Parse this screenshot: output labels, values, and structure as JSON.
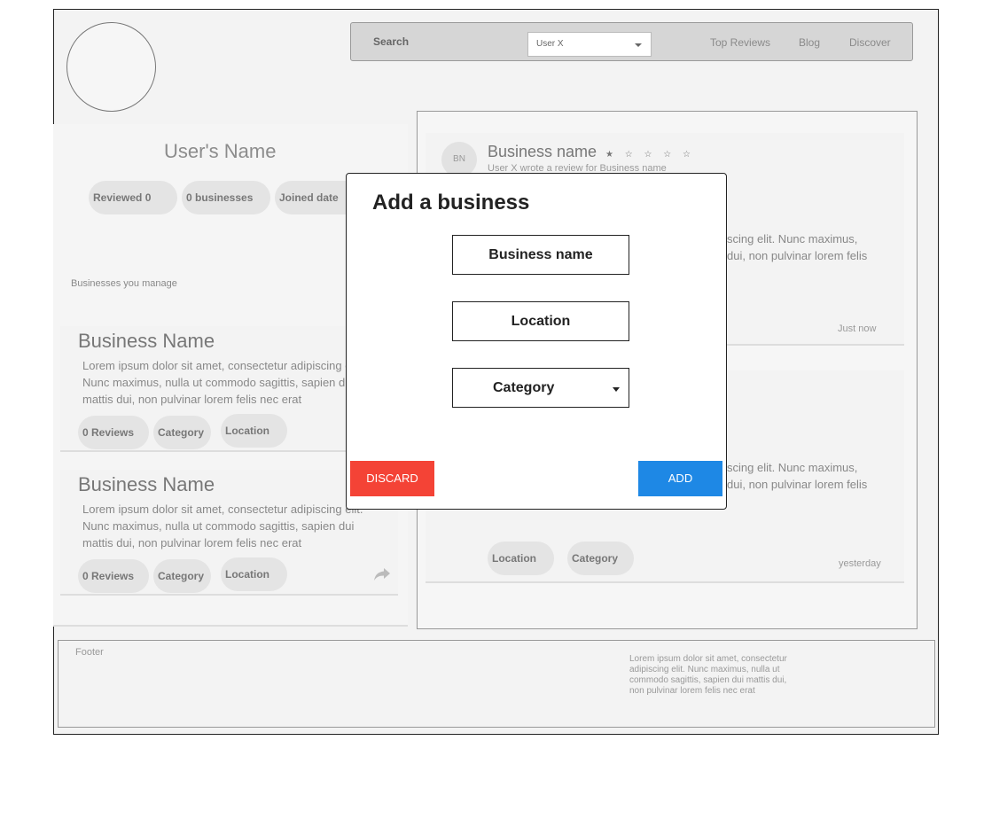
{
  "nav": {
    "search_label": "Search",
    "user_select_value": "User X",
    "links": [
      "Top Reviews",
      "Blog",
      "Discover"
    ]
  },
  "profile": {
    "user_name": "User's Name",
    "stats": [
      "Reviewed 0",
      "0 businesses",
      "Joined date"
    ]
  },
  "managed": {
    "section_label": "Businesses you manage",
    "businesses": [
      {
        "name": "Business Name",
        "desc": "Lorem ipsum dolor sit amet, consectetur adipiscing elit. Nunc maximus, nulla ut commodo sagittis, sapien dui mattis dui, non pulvinar lorem felis nec erat",
        "reviews": "0 Reviews",
        "category": "Category",
        "location": "Location"
      },
      {
        "name": "Business Name",
        "desc": "Lorem ipsum dolor sit amet, consectetur adipiscing elit. Nunc maximus, nulla ut commodo sagittis, sapien dui mattis dui, non pulvinar lorem felis nec erat",
        "reviews": "0 Reviews",
        "category": "Category",
        "location": "Location"
      }
    ]
  },
  "reviews": [
    {
      "avatar_initials": "BN",
      "business_name": "Business name",
      "stars": "★ ☆ ☆ ☆ ☆",
      "subtitle": "User X wrote a review for Business name",
      "body_visible_line1": "scing elit. Nunc maximus,",
      "body_visible_line2": "dui, non pulvinar lorem felis",
      "time": "Just now"
    },
    {
      "body_visible_line1": "scing elit. Nunc maximus,",
      "body_visible_line2": "dui, non pulvinar lorem felis",
      "location": "Location",
      "category": "Category",
      "time": "yesterday"
    }
  ],
  "footer": {
    "label": "Footer",
    "text": "Lorem ipsum dolor sit amet, consectetur adipiscing elit. Nunc maximus, nulla ut commodo sagittis, sapien dui mattis dui, non pulvinar lorem felis nec erat"
  },
  "modal": {
    "title": "Add a business",
    "name_field": "Business name",
    "location_field": "Location",
    "category_field": "Category",
    "discard_label": "DISCARD",
    "add_label": "ADD"
  },
  "colors": {
    "discard": "#f44336",
    "add": "#1e88e5"
  }
}
